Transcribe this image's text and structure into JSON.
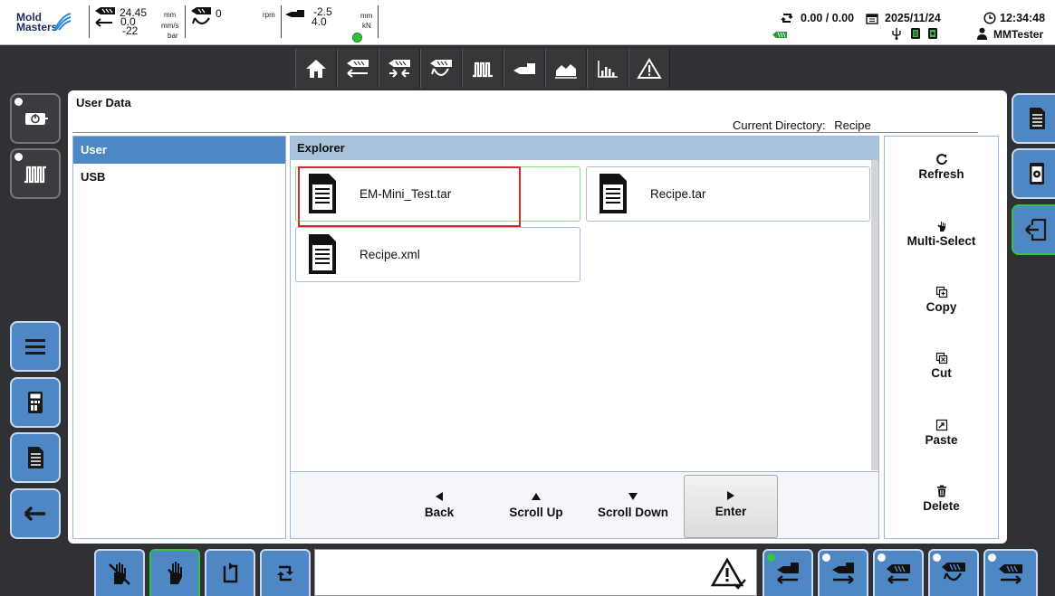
{
  "topbar": {
    "logo": {
      "line1": "Mold",
      "line2": "Masters"
    },
    "speed_group": {
      "value1": "24.45",
      "value2": "0.0",
      "value3": "-22",
      "unit1": "mm",
      "unit2": "mm/s",
      "unit3": "bar"
    },
    "rotation": {
      "value": "0",
      "unit": "rpm"
    },
    "clamp": {
      "value1": "-2.5",
      "value2": "4.0",
      "unit1": "mm",
      "unit2": "kN"
    },
    "cycle": "0.00 / 0.00",
    "date": "2025/11/24",
    "time": "12:34:48",
    "user": "MMTester"
  },
  "nav": {
    "icons": [
      "home-icon",
      "injection-unit-icon",
      "clamp-icon",
      "screw-rotation-icon",
      "heater-icon",
      "nozzle-icon",
      "profile-chart-icon",
      "bar-chart-icon",
      "alarm-icon"
    ]
  },
  "panel": {
    "title": "User Data",
    "current_directory_label": "Current Directory:",
    "current_directory_value": "Recipe"
  },
  "locations": [
    {
      "label": "User",
      "selected": true
    },
    {
      "label": "USB",
      "selected": false
    }
  ],
  "explorer": {
    "header": "Explorer",
    "files": [
      {
        "name": "EM-Mini_Test.tar",
        "highlighted": true
      },
      {
        "name": "Recipe.tar",
        "highlighted": false
      },
      {
        "name": "Recipe.xml",
        "highlighted": false
      }
    ],
    "footer": {
      "back": "Back",
      "scroll_up": "Scroll Up",
      "scroll_down": "Scroll Down",
      "enter": "Enter"
    }
  },
  "actions": {
    "refresh": "Refresh",
    "multi_select": "Multi-Select",
    "copy": "Copy",
    "cut": "Cut",
    "paste": "Paste",
    "delete": "Delete"
  },
  "colors": {
    "accent": "#4f87c5",
    "highlight_red": "#d9262b",
    "active_green": "#35c24a",
    "header_blue": "#a9c3dc"
  }
}
